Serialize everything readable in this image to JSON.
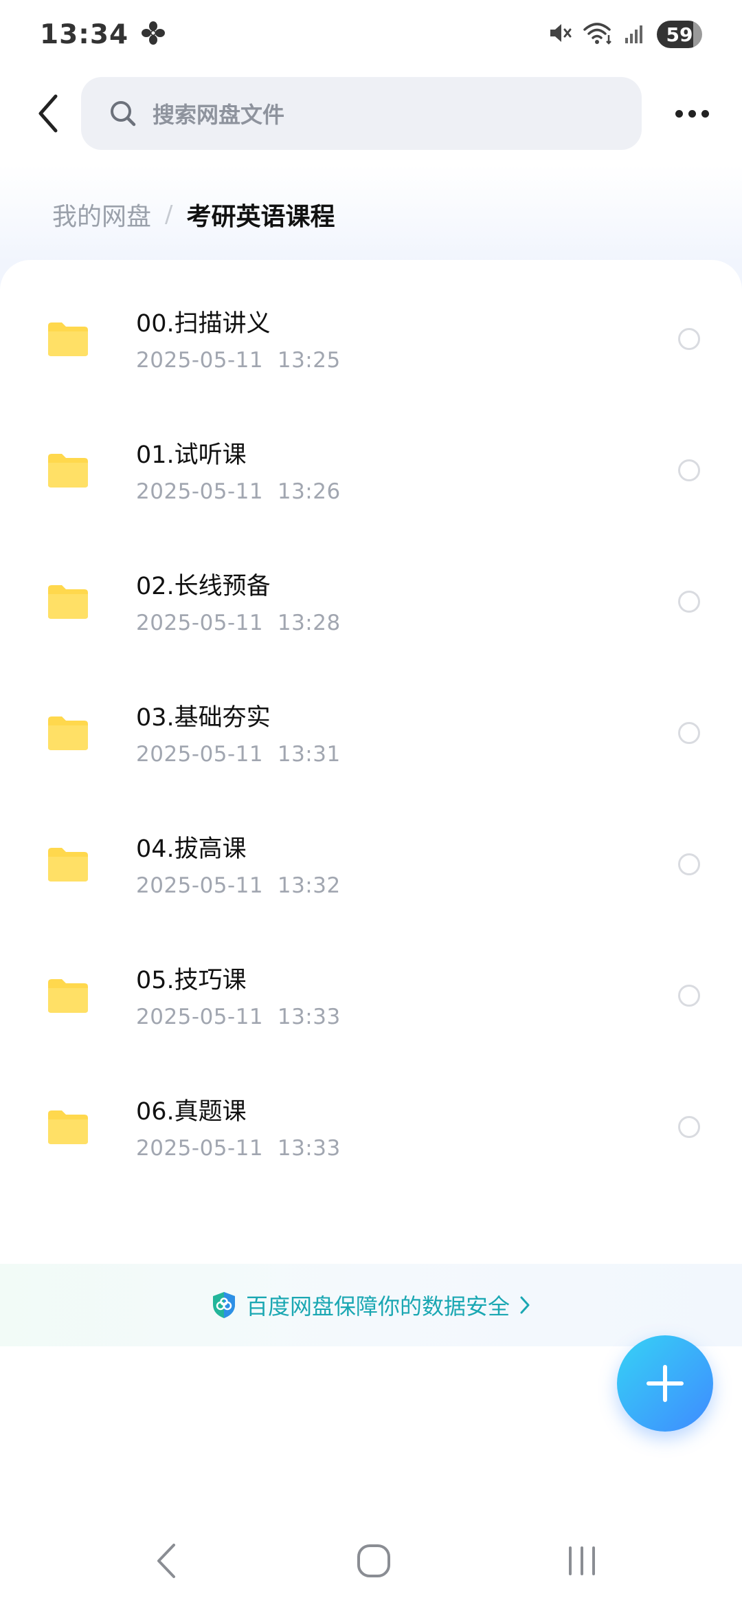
{
  "status_bar": {
    "time": "13:34",
    "battery": "59",
    "icons": [
      "fan-icon",
      "mute-icon",
      "wifi-icon",
      "signal-icon"
    ]
  },
  "top_bar": {
    "search_placeholder": "搜索网盘文件"
  },
  "breadcrumb": {
    "root": "我的网盘",
    "separator": "/",
    "current": "考研英语课程"
  },
  "files": [
    {
      "name": "00.扫描讲义",
      "date": "2025-05-11  13:25"
    },
    {
      "name": "01.试听课",
      "date": "2025-05-11  13:26"
    },
    {
      "name": "02.长线预备",
      "date": "2025-05-11  13:28"
    },
    {
      "name": "03.基础夯实",
      "date": "2025-05-11  13:31"
    },
    {
      "name": "04.拔高课",
      "date": "2025-05-11  13:32"
    },
    {
      "name": "05.技巧课",
      "date": "2025-05-11  13:33"
    },
    {
      "name": "06.真题课",
      "date": "2025-05-11  13:33"
    }
  ],
  "security_banner": {
    "text": "百度网盘保障你的数据安全"
  },
  "colors": {
    "folder": "#FFD84D",
    "accent": "#3F8BFF",
    "security_text": "#1AA7B2"
  }
}
